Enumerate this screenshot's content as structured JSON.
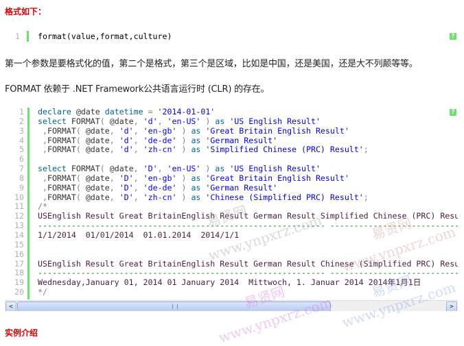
{
  "heading_format": "格式如下：",
  "snippet1": {
    "line_number": "1",
    "code": "format(value,format,culture)",
    "help_label": "?"
  },
  "para1": "第一个参数是要格式化的值，第二个是格式，第三个是区域，比如是中国，还是美国，还是大不列颠等等。",
  "para2": "FORMAT 依赖于 .NET Framework公共语言运行时 (CLR) 的存在。",
  "snippet2": {
    "help_label": "?",
    "lines": [
      [
        [
          "kw",
          "declare "
        ],
        [
          "var",
          "@date "
        ],
        [
          "kw",
          "datetime "
        ],
        [
          "op",
          "= "
        ],
        [
          "str",
          "'2014-01-01'"
        ]
      ],
      [
        [
          "kw",
          "select "
        ],
        [
          "fn",
          "FORMAT"
        ],
        [
          "op",
          "( "
        ],
        [
          "var",
          "@date"
        ],
        [
          "op",
          ", "
        ],
        [
          "str",
          "'d'"
        ],
        [
          "op",
          ", "
        ],
        [
          "str",
          "'en-US'"
        ],
        [
          "op",
          " ) "
        ],
        [
          "kw",
          "as "
        ],
        [
          "str",
          "'US English Result'"
        ]
      ],
      [
        [
          "op",
          " ,"
        ],
        [
          "fn",
          "FORMAT"
        ],
        [
          "op",
          "( "
        ],
        [
          "var",
          "@date"
        ],
        [
          "op",
          ", "
        ],
        [
          "str",
          "'d'"
        ],
        [
          "op",
          ", "
        ],
        [
          "str",
          "'en-gb'"
        ],
        [
          "op",
          " ) "
        ],
        [
          "kw",
          "as "
        ],
        [
          "str",
          "'Great Britain English Result'"
        ]
      ],
      [
        [
          "op",
          " ,"
        ],
        [
          "fn",
          "FORMAT"
        ],
        [
          "op",
          "( "
        ],
        [
          "var",
          "@date"
        ],
        [
          "op",
          ", "
        ],
        [
          "str",
          "'d'"
        ],
        [
          "op",
          ", "
        ],
        [
          "str",
          "'de-de'"
        ],
        [
          "op",
          " ) "
        ],
        [
          "kw",
          "as "
        ],
        [
          "str",
          "'German Result'"
        ]
      ],
      [
        [
          "op",
          " ,"
        ],
        [
          "fn",
          "FORMAT"
        ],
        [
          "op",
          "( "
        ],
        [
          "var",
          "@date"
        ],
        [
          "op",
          ", "
        ],
        [
          "str",
          "'d'"
        ],
        [
          "op",
          ", "
        ],
        [
          "str",
          "'zh-cn'"
        ],
        [
          "op",
          " ) "
        ],
        [
          "kw",
          "as "
        ],
        [
          "str",
          "'Simplified Chinese (PRC) Result'"
        ],
        [
          "op",
          ";"
        ]
      ],
      [],
      [
        [
          "kw",
          "select "
        ],
        [
          "fn",
          "FORMAT"
        ],
        [
          "op",
          "( "
        ],
        [
          "var",
          "@date"
        ],
        [
          "op",
          ", "
        ],
        [
          "str",
          "'D'"
        ],
        [
          "op",
          ", "
        ],
        [
          "str",
          "'en-US'"
        ],
        [
          "op",
          " ) "
        ],
        [
          "kw",
          "as "
        ],
        [
          "str",
          "'US English Result'"
        ]
      ],
      [
        [
          "op",
          " ,"
        ],
        [
          "fn",
          "FORMAT"
        ],
        [
          "op",
          "( "
        ],
        [
          "var",
          "@date"
        ],
        [
          "op",
          ", "
        ],
        [
          "str",
          "'D'"
        ],
        [
          "op",
          ", "
        ],
        [
          "str",
          "'en-gb'"
        ],
        [
          "op",
          " ) "
        ],
        [
          "kw",
          "as "
        ],
        [
          "str",
          "'Great Britain English Result'"
        ]
      ],
      [
        [
          "op",
          " ,"
        ],
        [
          "fn",
          "FORMAT"
        ],
        [
          "op",
          "( "
        ],
        [
          "var",
          "@date"
        ],
        [
          "op",
          ", "
        ],
        [
          "str",
          "'D'"
        ],
        [
          "op",
          ", "
        ],
        [
          "str",
          "'de-de'"
        ],
        [
          "op",
          " ) "
        ],
        [
          "kw",
          "as "
        ],
        [
          "str",
          "'German Result'"
        ]
      ],
      [
        [
          "op",
          " ,"
        ],
        [
          "fn",
          "FORMAT"
        ],
        [
          "op",
          "( "
        ],
        [
          "var",
          "@date"
        ],
        [
          "op",
          ", "
        ],
        [
          "str",
          "'D'"
        ],
        [
          "op",
          ", "
        ],
        [
          "str",
          "'zh-cn'"
        ],
        [
          "op",
          " ) "
        ],
        [
          "kw",
          "as "
        ],
        [
          "str",
          "'Chinese (Simplified PRC) Result'"
        ],
        [
          "op",
          ";"
        ]
      ],
      [
        [
          "op",
          "/*"
        ]
      ],
      [
        [
          "cm",
          "USEnglish Result Great BritainEnglish Result German Result Simplified Chinese (PRC) Result"
        ]
      ],
      [
        [
          "dash",
          "------------------------------------------------------------ ------------------------------"
        ]
      ],
      [
        [
          "cm",
          "1/1/2014  01/01/2014  01.01.2014  2014/1/1"
        ]
      ],
      [],
      [],
      [
        [
          "cm",
          "USEnglish Result Great BritainEnglish Result German Result Chinese (Simplified PRC) Result"
        ]
      ],
      [
        [
          "dash",
          "------------------------------------------------------------ ------------------------------"
        ]
      ],
      [
        [
          "cm",
          "Wednesday,January 01, 2014 01 January 2014  Mittwoch, 1. Januar 2014 2014年1月1日"
        ]
      ],
      [
        [
          "op",
          "*/"
        ]
      ]
    ]
  },
  "scrollbar": {
    "left_arrow": "<",
    "right_arrow": ">"
  },
  "heading_example": "实例介绍",
  "watermark": {
    "site_cn": "易贤网",
    "site_url": "www.ynpxrz.com"
  }
}
